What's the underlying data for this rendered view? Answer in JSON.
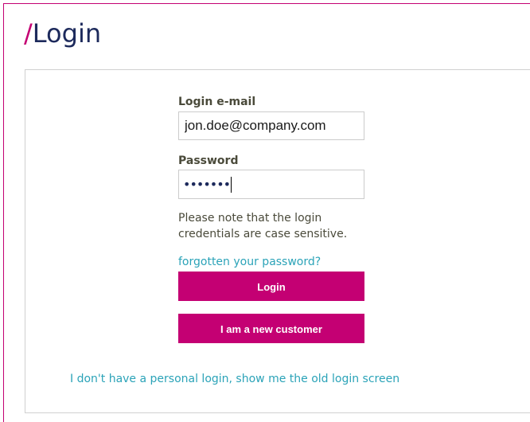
{
  "page": {
    "title_slash": "/",
    "title": "Login"
  },
  "form": {
    "email_label": "Login e-mail",
    "email_value": "jon.doe@company.com",
    "password_label": "Password",
    "password_mask": "•••••••",
    "case_note": "Please note that the login credentials are case sensitive.",
    "forgot_link": "forgotten your password?",
    "login_button": "Login",
    "new_customer_button": "I am a new customer"
  },
  "footer": {
    "old_login_link": "I don't have a personal login, show me the old login screen"
  },
  "colors": {
    "accent": "#c40073",
    "link": "#2ba3b8",
    "title": "#1d2a5c"
  }
}
